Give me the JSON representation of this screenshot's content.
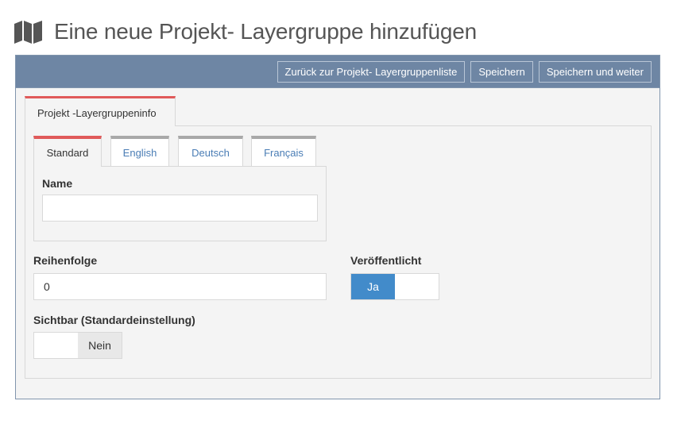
{
  "header": {
    "title": "Eine neue Projekt- Layergruppe hinzufügen",
    "icon": "map-icon"
  },
  "toolbar": {
    "back_label": "Zurück zur Projekt- Layergruppenliste",
    "save_label": "Speichern",
    "save_continue_label": "Speichern und weiter"
  },
  "outer_tab": {
    "label": "Projekt -Layergruppeninfo"
  },
  "language_tabs": [
    {
      "label": "Standard",
      "active": true
    },
    {
      "label": "English",
      "active": false
    },
    {
      "label": "Deutsch",
      "active": false
    },
    {
      "label": "Français",
      "active": false
    }
  ],
  "form": {
    "name": {
      "label": "Name",
      "value": ""
    },
    "order": {
      "label": "Reihenfolge",
      "value": "0"
    },
    "published": {
      "label": "Veröffentlicht",
      "state_label": "Ja",
      "on": true
    },
    "visible": {
      "label": "Sichtbar (Standardeinstellung)",
      "state_label": "Nein",
      "on": false
    }
  },
  "colors": {
    "toolbar_bg": "#6e86a4",
    "active_tab_accent": "#e05a5a",
    "toggle_on": "#428bca",
    "link": "#4a7db5"
  }
}
